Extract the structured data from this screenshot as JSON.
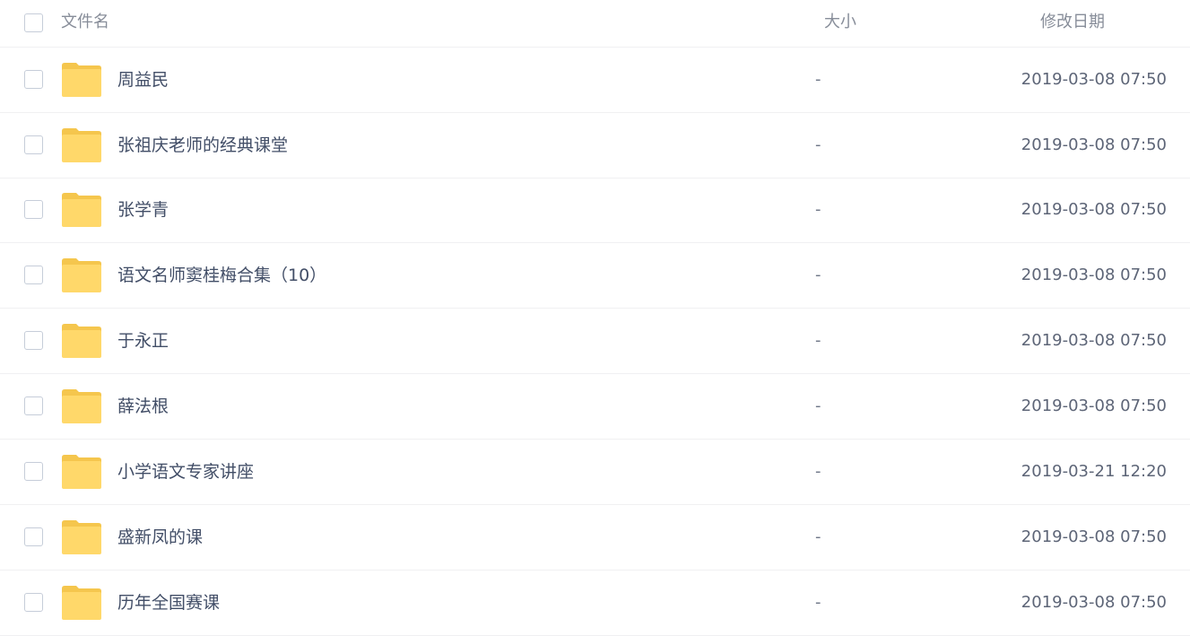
{
  "header": {
    "name_label": "文件名",
    "size_label": "大小",
    "date_label": "修改日期"
  },
  "files": [
    {
      "name": "周益民",
      "size": "-",
      "modified": "2019-03-08 07:50",
      "icon": "folder-icon"
    },
    {
      "name": "张祖庆老师的经典课堂",
      "size": "-",
      "modified": "2019-03-08 07:50",
      "icon": "folder-icon"
    },
    {
      "name": "张学青",
      "size": "-",
      "modified": "2019-03-08 07:50",
      "icon": "folder-icon"
    },
    {
      "name": "语文名师窦桂梅合集（10）",
      "size": "-",
      "modified": "2019-03-08 07:50",
      "icon": "folder-icon"
    },
    {
      "name": "于永正",
      "size": "-",
      "modified": "2019-03-08 07:50",
      "icon": "folder-icon"
    },
    {
      "name": "薛法根",
      "size": "-",
      "modified": "2019-03-08 07:50",
      "icon": "folder-icon"
    },
    {
      "name": "小学语文专家讲座",
      "size": "-",
      "modified": "2019-03-21 12:20",
      "icon": "folder-icon"
    },
    {
      "name": "盛新凤的课",
      "size": "-",
      "modified": "2019-03-08 07:50",
      "icon": "folder-icon"
    },
    {
      "name": "历年全国赛课",
      "size": "-",
      "modified": "2019-03-08 07:50",
      "icon": "folder-icon"
    }
  ],
  "colors": {
    "folder_body": "#FFD86A",
    "folder_tab": "#F5C64D",
    "divider": "#F0F0F2",
    "checkbox_border": "#C6CDD9"
  }
}
